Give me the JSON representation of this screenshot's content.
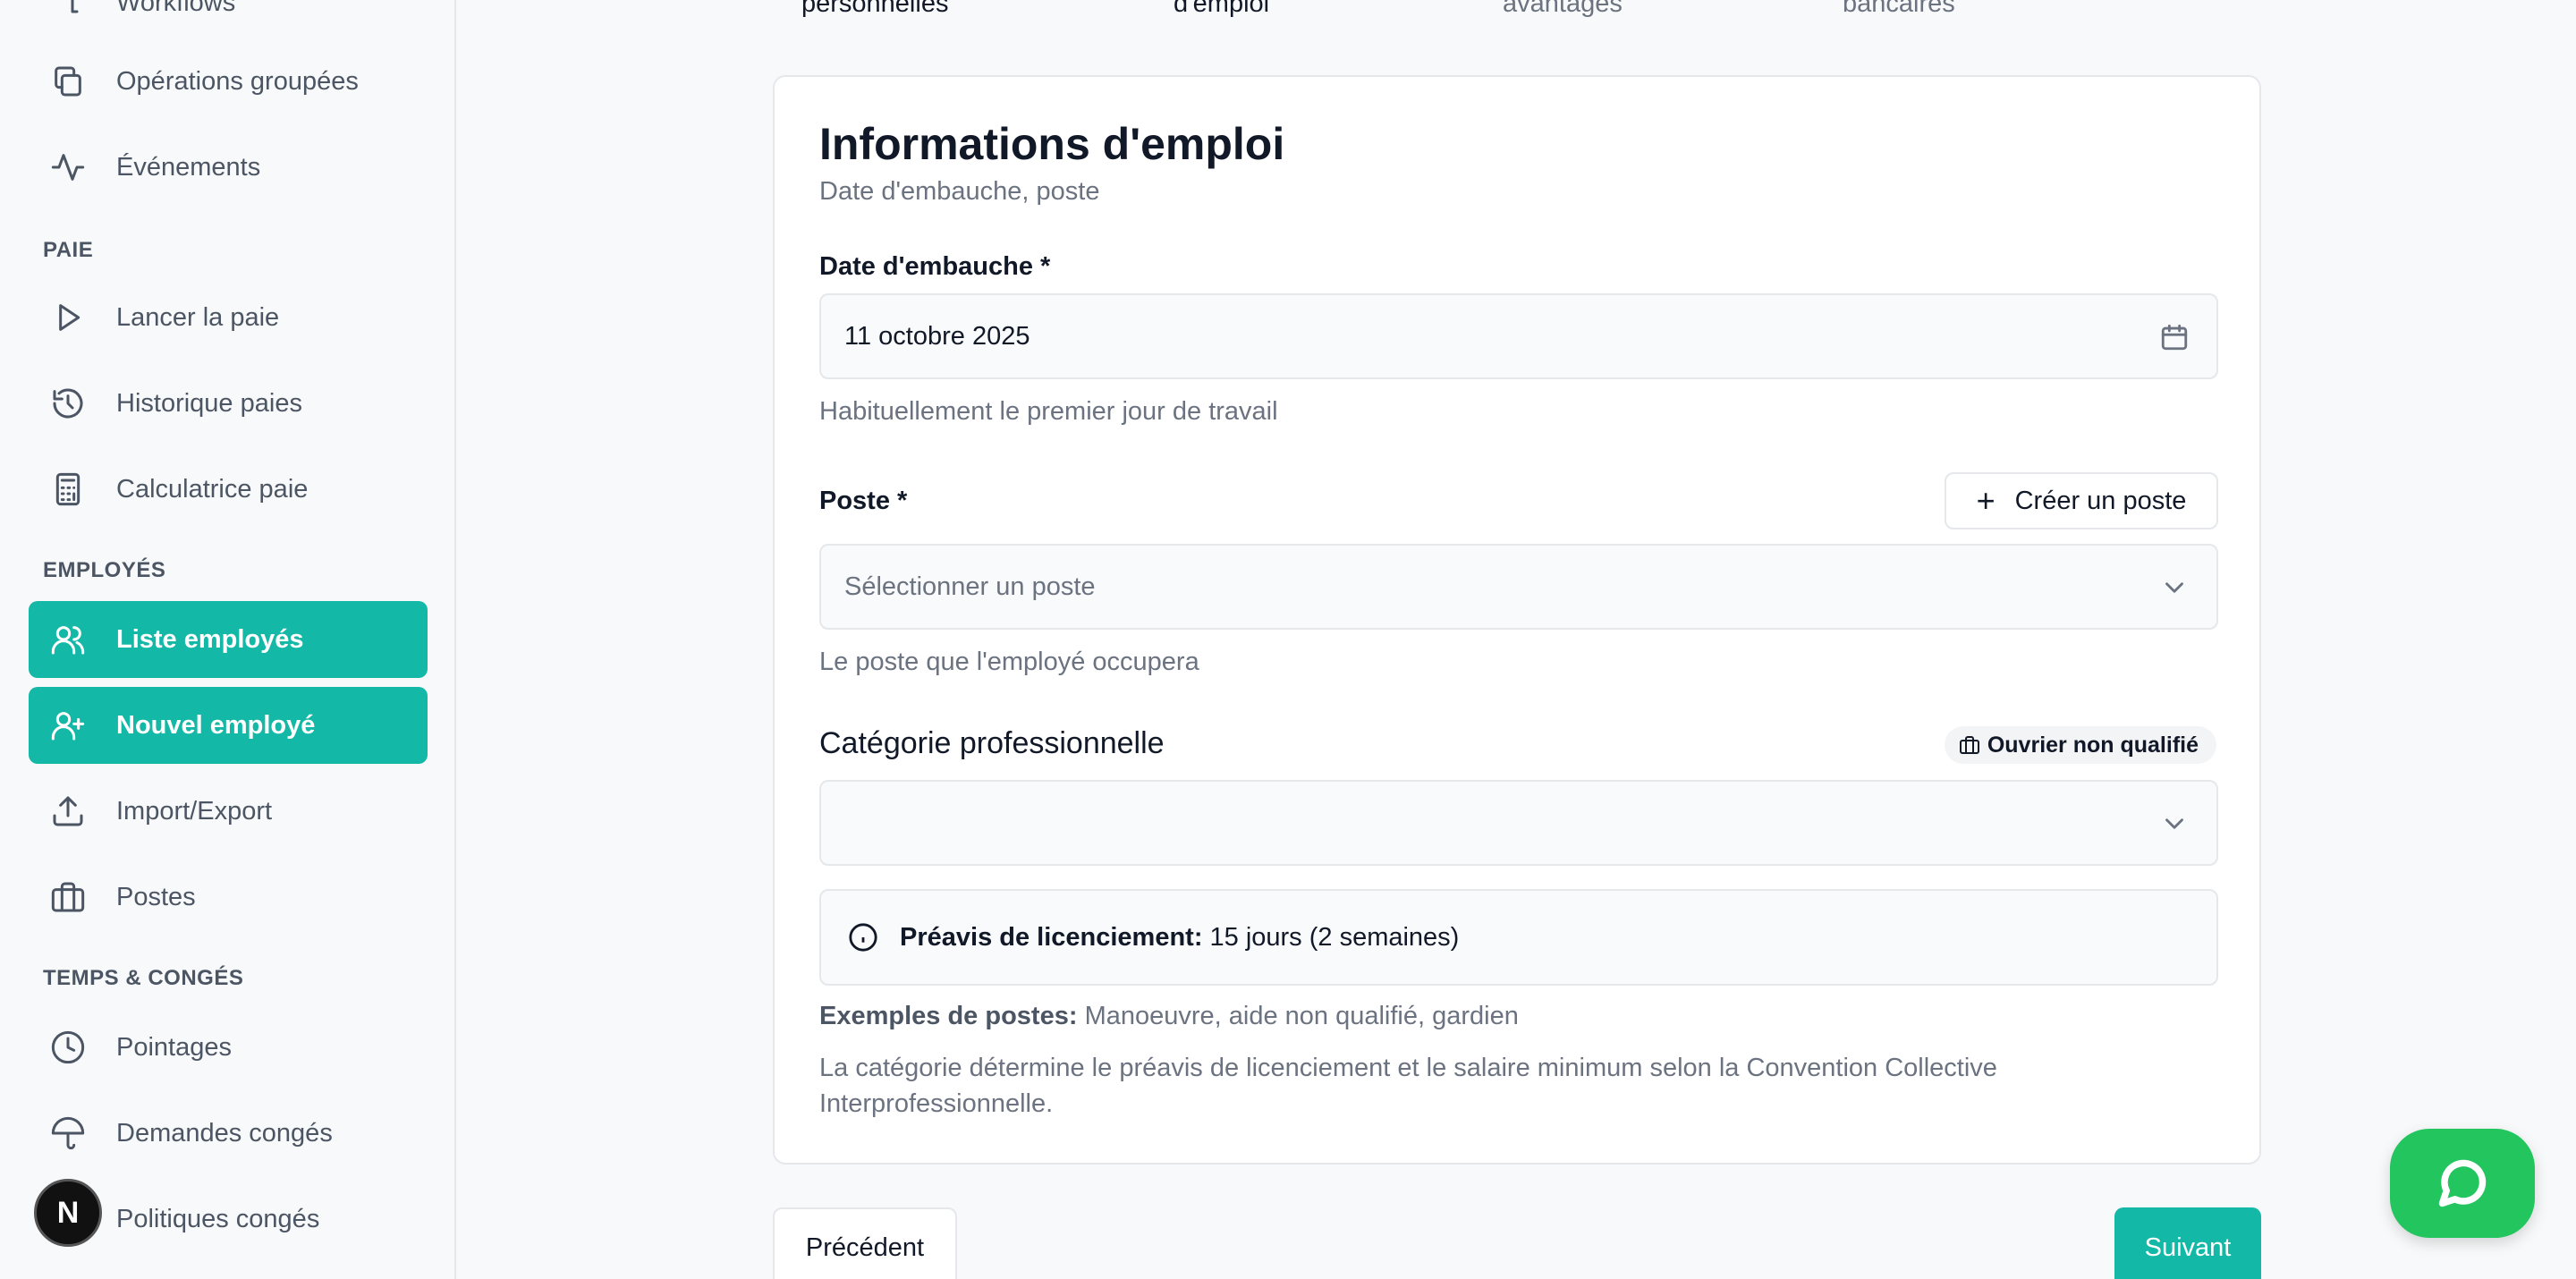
{
  "sidebar": {
    "partial_top_label": "Workflows",
    "items_top": [
      {
        "label": "Opérations groupées",
        "icon": "copy-icon"
      },
      {
        "label": "Événements",
        "icon": "activity-icon"
      }
    ],
    "sections": [
      {
        "title": "PAIE",
        "items": [
          {
            "label": "Lancer la paie",
            "icon": "play-icon"
          },
          {
            "label": "Historique paies",
            "icon": "history-icon"
          },
          {
            "label": "Calculatrice paie",
            "icon": "calculator-icon"
          }
        ]
      },
      {
        "title": "EMPLOYÉS",
        "items": [
          {
            "label": "Liste employés",
            "icon": "users-icon",
            "active": true
          },
          {
            "label": "Nouvel employé",
            "icon": "user-plus-icon",
            "active": true
          },
          {
            "label": "Import/Export",
            "icon": "upload-icon"
          },
          {
            "label": "Postes",
            "icon": "briefcase-icon"
          }
        ]
      },
      {
        "title": "TEMPS & CONGÉS",
        "items": [
          {
            "label": "Pointages",
            "icon": "clock-icon"
          },
          {
            "label": "Demandes congés",
            "icon": "umbrella-icon"
          },
          {
            "label": "Politiques congés",
            "icon": "file-icon"
          }
        ]
      }
    ],
    "avatar_letter": "N"
  },
  "stepper": {
    "steps": [
      "personnelles",
      "d'emploi",
      "avantages",
      "bancaires"
    ]
  },
  "form": {
    "title": "Informations d'emploi",
    "subtitle": "Date d'embauche, poste",
    "hire_date": {
      "label": "Date d'embauche *",
      "value": "11 octobre 2025",
      "help": "Habituellement le premier jour de travail"
    },
    "position": {
      "label": "Poste *",
      "create_button": "Créer un poste",
      "placeholder": "Sélectionner un poste",
      "help": "Le poste que l'employé occupera"
    },
    "category": {
      "label": "Catégorie professionnelle",
      "badge": "Ouvrier non qualifié",
      "value": ""
    },
    "notice": {
      "label": "Préavis de licenciement:",
      "value": "15 jours (2 semaines)"
    },
    "examples": {
      "label": "Exemples de postes:",
      "value": "Manoeuvre, aide non qualifié, gardien"
    },
    "description": "La catégorie détermine le préavis de licenciement et le salaire minimum selon la Convention Collective Interprofessionnelle."
  },
  "footer": {
    "prev_label": "Précédent",
    "next_label": "Suivant"
  },
  "colors": {
    "accent": "#14b8a6",
    "chat": "#22c55e"
  }
}
